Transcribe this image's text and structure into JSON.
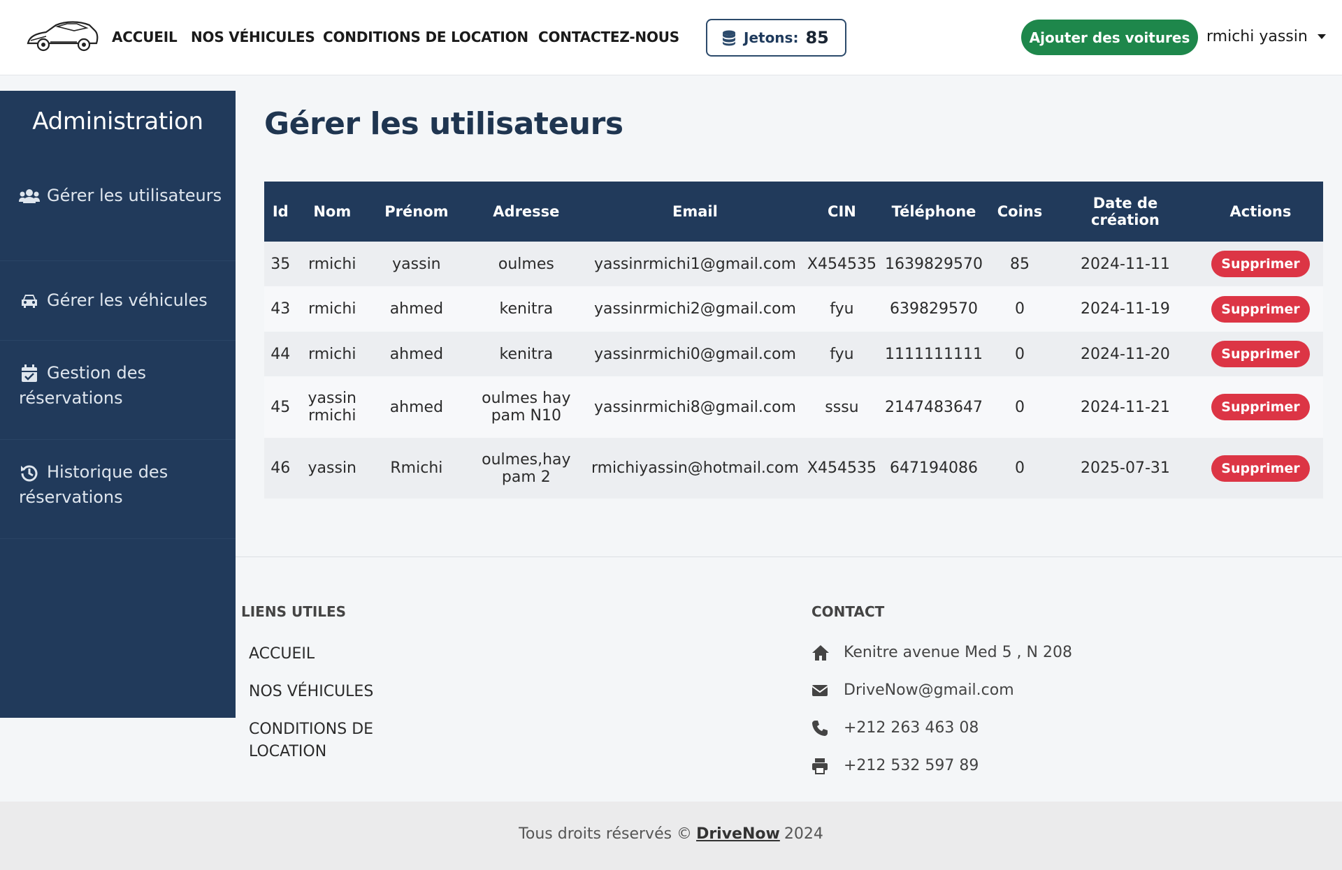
{
  "nav": {
    "links": [
      "ACCUEIL",
      "NOS VÉHICULES",
      "CONDITIONS DE LOCATION",
      "CONTACTEZ-NOUS"
    ],
    "coins_label": "Jetons:",
    "coins_value": "85",
    "add_cars_label": "Ajouter des voitures",
    "user_name": "rmichi yassin"
  },
  "sidebar": {
    "title": "Administration",
    "items": [
      {
        "label": "Gérer les utilisateurs",
        "icon": "users-icon"
      },
      {
        "label": "Gérer les véhicules",
        "icon": "car-icon"
      },
      {
        "label": "Gestion des réservations",
        "icon": "calendar-check-icon"
      },
      {
        "label": "Historique des réservations",
        "icon": "history-icon"
      }
    ]
  },
  "main": {
    "title": "Gérer les utilisateurs",
    "columns": [
      "Id",
      "Nom",
      "Prénom",
      "Adresse",
      "Email",
      "CIN",
      "Téléphone",
      "Coins",
      "Date de création",
      "Actions"
    ],
    "rows": [
      {
        "id": "35",
        "nom": "rmichi",
        "prenom": "yassin",
        "adresse": "oulmes",
        "email": "yassinrmichi1@gmail.com",
        "cin": "X454535",
        "telephone": "1639829570",
        "coins": "85",
        "date": "2024-11-11",
        "action": "Supprimer"
      },
      {
        "id": "43",
        "nom": "rmichi",
        "prenom": "ahmed",
        "adresse": "kenitra",
        "email": "yassinrmichi2@gmail.com",
        "cin": "fyu",
        "telephone": "639829570",
        "coins": "0",
        "date": "2024-11-19",
        "action": "Supprimer"
      },
      {
        "id": "44",
        "nom": "rmichi",
        "prenom": "ahmed",
        "adresse": "kenitra",
        "email": "yassinrmichi0@gmail.com",
        "cin": "fyu",
        "telephone": "1111111111",
        "coins": "0",
        "date": "2024-11-20",
        "action": "Supprimer"
      },
      {
        "id": "45",
        "nom": "yassin rmichi",
        "prenom": "ahmed",
        "adresse": "oulmes hay pam N10",
        "email": "yassinrmichi8@gmail.com",
        "cin": "sssu",
        "telephone": "2147483647",
        "coins": "0",
        "date": "2024-11-21",
        "action": "Supprimer"
      },
      {
        "id": "46",
        "nom": "yassin",
        "prenom": "Rmichi",
        "adresse": "oulmes,hay pam 2",
        "email": "rmichiyassin@hotmail.com",
        "cin": "X454535",
        "telephone": "647194086",
        "coins": "0",
        "date": "2025-07-31",
        "action": "Supprimer"
      }
    ]
  },
  "footer": {
    "links_heading": "LIENS UTILES",
    "links": [
      "ACCUEIL",
      "NOS VÉHICULES",
      "CONDITIONS DE LOCATION"
    ],
    "contact_heading": "CONTACT",
    "contact": [
      {
        "icon": "home-icon",
        "text": "Kenitre avenue Med 5 , N 208"
      },
      {
        "icon": "envelope-icon",
        "text": "DriveNow@gmail.com"
      },
      {
        "icon": "phone-icon",
        "text": "+212 263 463 08"
      },
      {
        "icon": "printer-icon",
        "text": "+212 532 597 89"
      }
    ],
    "copyright_prefix": "Tous droits réservés ©",
    "brand": "DriveNow",
    "year": "2024"
  },
  "colors": {
    "navy": "#213a5b",
    "green": "#1e874b",
    "danger": "#dc3545"
  }
}
